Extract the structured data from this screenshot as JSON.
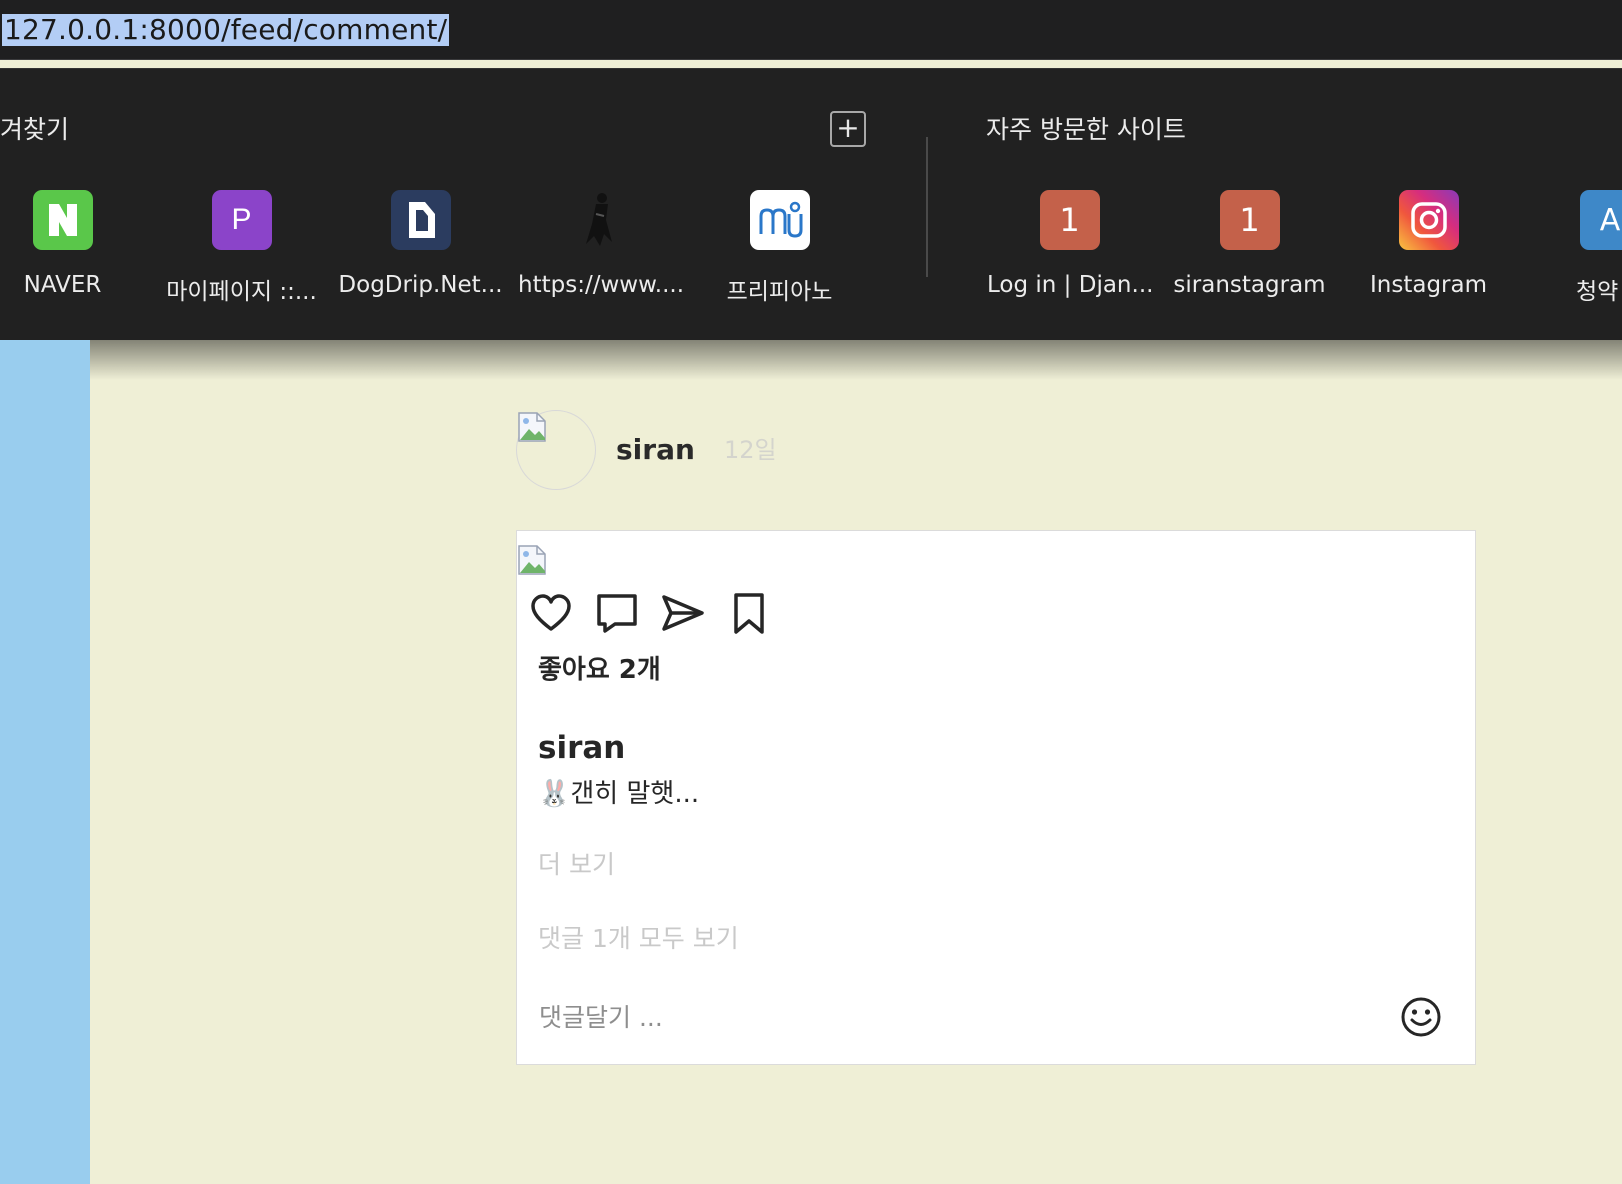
{
  "urlbar": {
    "url": "127.0.0.1:8000/feed/comment/"
  },
  "bookmarks": {
    "title": "겨찾기",
    "add_label": "+",
    "items": [
      {
        "label": "NAVER",
        "tile_text": "N",
        "color": "#5ac74a",
        "icon": "naver-icon"
      },
      {
        "label": "마이페이지 ::...",
        "tile_text": "P",
        "color": "#8b44c9",
        "icon": "p-icon"
      },
      {
        "label": "DogDrip.Net...",
        "tile_text": "",
        "color": "#2b3c5f",
        "icon": "dogdrip-icon"
      },
      {
        "label": "https://www....",
        "tile_text": "",
        "color": "transparent",
        "icon": "silhouette-icon"
      },
      {
        "label": "프리피아노",
        "tile_text": "",
        "color": "#ffffff",
        "icon": "musescore-icon"
      }
    ]
  },
  "frequent": {
    "title": "자주 방문한 사이트",
    "items": [
      {
        "label": "Log in | Djan...",
        "tile_text": "1",
        "color": "#c4614a",
        "icon": "letter-tile-icon"
      },
      {
        "label": "siranstagram",
        "tile_text": "1",
        "color": "#c4614a",
        "icon": "letter-tile-icon"
      },
      {
        "label": "Instagram",
        "tile_text": "",
        "color": "#e1306c",
        "icon": "instagram-icon"
      },
      {
        "label": "청약",
        "tile_text": "A",
        "color": "#3e88c8",
        "icon": "letter-tile-icon"
      }
    ]
  },
  "post": {
    "username": "siran",
    "date": "12일",
    "likes": "좋아요 2개",
    "author": "siran",
    "caption": "🐰갠히 말햇...",
    "more": "더 보기",
    "all_comments": "댓글 1개 모두 보기",
    "comment_placeholder": "댓글달기 ..."
  }
}
